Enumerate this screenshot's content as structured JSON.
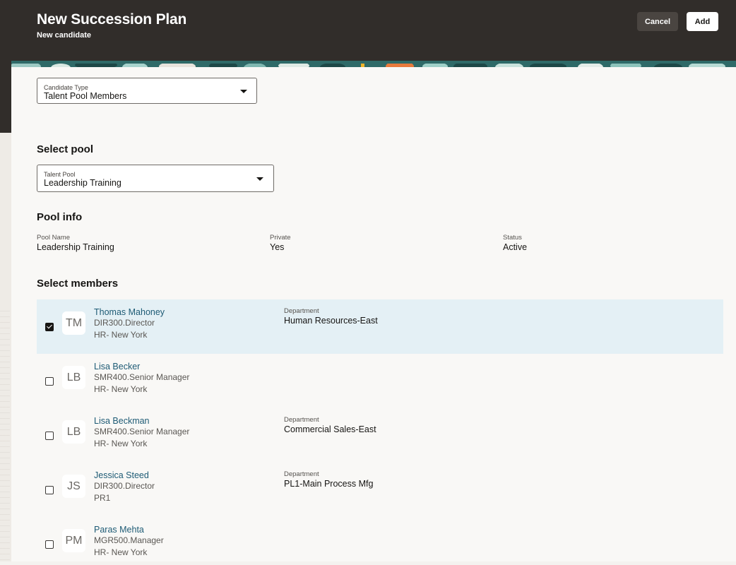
{
  "header": {
    "title": "New Succession Plan",
    "subtitle": "New candidate",
    "cancel_label": "Cancel",
    "add_label": "Add"
  },
  "candidate_type": {
    "label": "Candidate Type",
    "value": "Talent Pool Members"
  },
  "select_pool": {
    "heading": "Select pool",
    "label": "Talent Pool",
    "value": "Leadership Training"
  },
  "pool_info": {
    "heading": "Pool info",
    "name_label": "Pool Name",
    "name_value": "Leadership Training",
    "private_label": "Private",
    "private_value": "Yes",
    "status_label": "Status",
    "status_value": "Active"
  },
  "members": {
    "heading": "Select members",
    "items": [
      {
        "initials": "TM",
        "name": "Thomas Mahoney",
        "job": "DIR300.Director",
        "location": "HR- New York",
        "dept_label": "Department",
        "dept": "Human Resources-East",
        "checked": true
      },
      {
        "initials": "LB",
        "name": "Lisa Becker",
        "job": "SMR400.Senior Manager",
        "location": "HR- New York",
        "checked": false
      },
      {
        "initials": "LB",
        "name": "Lisa Beckman",
        "job": "SMR400.Senior Manager",
        "location": "HR- New York",
        "dept_label": "Department",
        "dept": "Commercial Sales-East",
        "checked": false
      },
      {
        "initials": "JS",
        "name": "Jessica Steed",
        "job": "DIR300.Director",
        "location": "PR1",
        "dept_label": "Department",
        "dept": "PL1-Main Process Mfg",
        "checked": false
      },
      {
        "initials": "PM",
        "name": "Paras Mehta",
        "job": "MGR500.Manager",
        "location": "HR- New York",
        "checked": false
      }
    ]
  },
  "colors": {
    "header_bg": "#312d2a",
    "link": "#1e5b75",
    "selected_row": "#e4f0f5",
    "panel_bg": "#f9f8f6"
  }
}
